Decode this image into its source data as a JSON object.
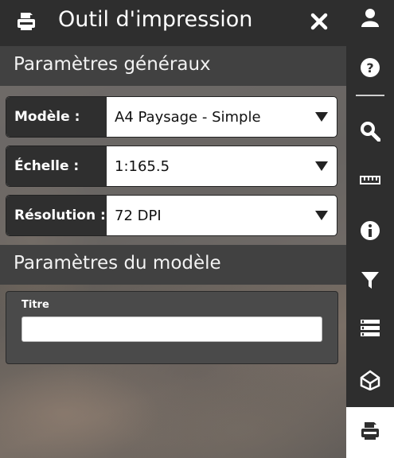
{
  "panel": {
    "title": "Outil d'impression",
    "title_icon": "printer-icon",
    "close_icon": "close-icon"
  },
  "general": {
    "heading": "Paramètres généraux",
    "fields": [
      {
        "label": "Modèle :",
        "value": "A4 Paysage - Simple"
      },
      {
        "label": "Échelle :",
        "value": "1:165.5"
      },
      {
        "label": "Résolution :",
        "value": "72 DPI"
      }
    ]
  },
  "model": {
    "heading": "Paramètres du modèle",
    "title_label": "Titre",
    "title_value": ""
  },
  "toolbar": {
    "items": [
      "user-icon",
      "help-icon",
      "search-icon",
      "measure-icon",
      "info-icon",
      "filter-icon",
      "layers-list-icon",
      "map-switch-icon",
      "printer-icon"
    ],
    "active": "printer-icon"
  },
  "colors": {
    "dark": "#2e2e2e",
    "header": "#414141",
    "active_tool": "#ffffff"
  }
}
